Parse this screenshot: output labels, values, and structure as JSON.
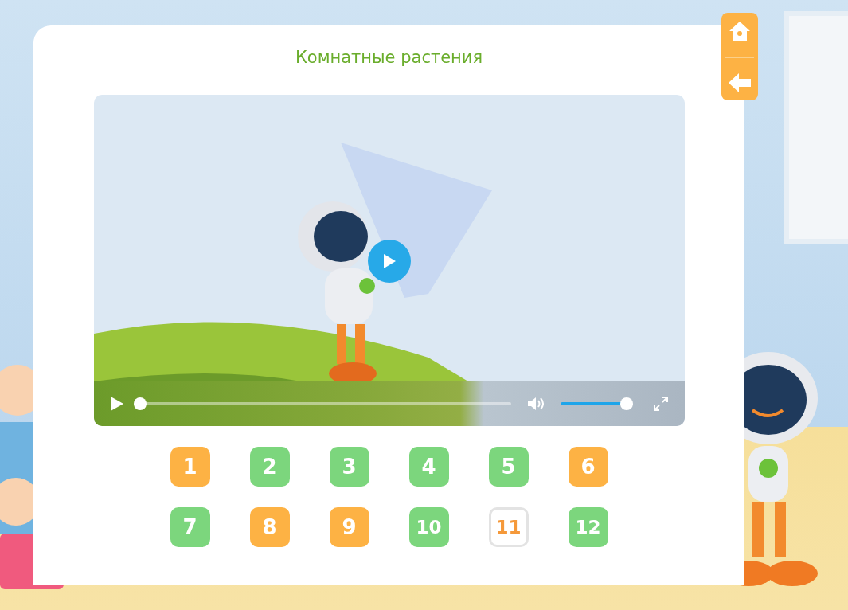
{
  "title": "Комнатные растения",
  "video": {
    "progress": {
      "level": 0.0
    },
    "volume": {
      "level": 0.97
    }
  },
  "lessons": [
    {
      "label": "1",
      "color": "#fdb244",
      "selected": false
    },
    {
      "label": "2",
      "color": "#7cd67d",
      "selected": false
    },
    {
      "label": "3",
      "color": "#7cd67d",
      "selected": false
    },
    {
      "label": "4",
      "color": "#7cd67d",
      "selected": false
    },
    {
      "label": "5",
      "color": "#7cd67d",
      "selected": false
    },
    {
      "label": "6",
      "color": "#fdb244",
      "selected": false
    },
    {
      "label": "7",
      "color": "#7cd67d",
      "selected": false
    },
    {
      "label": "8",
      "color": "#fdb244",
      "selected": false
    },
    {
      "label": "9",
      "color": "#fdb244",
      "selected": false
    },
    {
      "label": "10",
      "color": "#7cd67d",
      "selected": false
    },
    {
      "label": "11",
      "color": "#f5993a",
      "selected": true
    },
    {
      "label": "12",
      "color": "#7cd67d",
      "selected": false
    }
  ]
}
